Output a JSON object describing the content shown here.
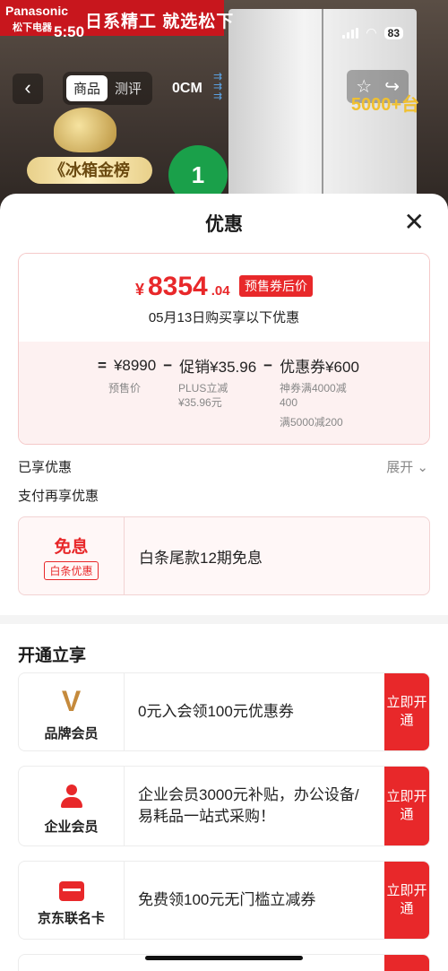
{
  "background": {
    "brand": "Panasonic",
    "brand_sub": "松下电器",
    "slogan": "日系精工 就选松下",
    "time": "5:50",
    "battery": "83",
    "nav_back": "‹",
    "tabs": [
      "商品",
      "测评"
    ],
    "ocm": "0CM",
    "promo": "5000+台",
    "gold_label": "《冰箱金榜",
    "energy_label": "1"
  },
  "sheet": {
    "title": "优惠",
    "close_icon": "close-icon"
  },
  "price": {
    "currency": "¥",
    "amount_int": "8354",
    "amount_dec": ".04",
    "tag": "预售券后价",
    "subtitle": "05月13日购买享以下优惠",
    "eq": "=",
    "presale": "¥8990",
    "minus1": "−",
    "promo": "促销¥35.96",
    "minus2": "−",
    "coupon": "优惠券¥600",
    "presale_label": "预售价",
    "promo_label_1": "PLUS立减",
    "promo_label_2": "¥35.96元",
    "coupon_label_1": "神券满4000减",
    "coupon_label_2": "400",
    "coupon_label_3": "满5000减200"
  },
  "enjoyed": {
    "label": "已享优惠",
    "expand": "展开 ⌄"
  },
  "pay": {
    "label": "支付再享优惠",
    "card_title": "免息",
    "card_tag": "白条优惠",
    "card_text": "白条尾款12期免息"
  },
  "open_section": {
    "title": "开通立享",
    "items": [
      {
        "icon": "v-icon",
        "label": "品牌会员",
        "text": "0元入会领100元优惠券",
        "btn": "立即开通"
      },
      {
        "icon": "person-icon",
        "label": "企业会员",
        "text": "企业会员3000元补贴，办公设备/易耗品一站式采购！",
        "btn": "立即开通"
      },
      {
        "icon": "card-icon",
        "label": "京东联名卡",
        "text": "免费领100元无门槛立减券",
        "btn": "立即开通"
      }
    ]
  }
}
